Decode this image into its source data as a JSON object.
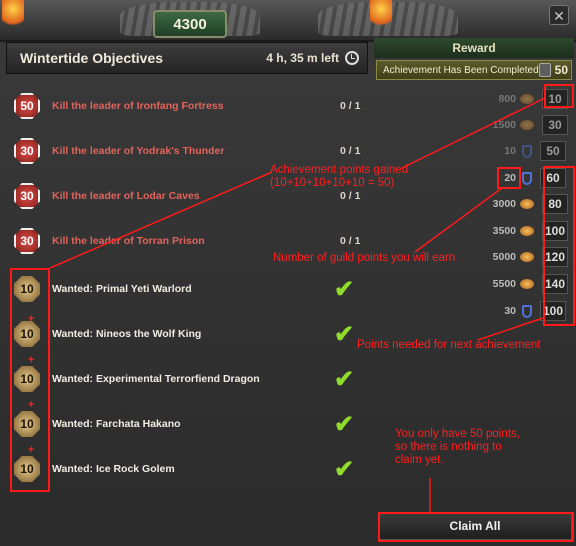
{
  "top": {
    "score": "4300"
  },
  "header": {
    "title": "Wintertide Objectives",
    "time_left": "4 h, 35 m left"
  },
  "reward": {
    "title": "Reward",
    "completed_label": "Achievement Has Been Completed",
    "completed_points": "50"
  },
  "objectives": [
    {
      "points": "50",
      "label": "Kill the leader of Ironfang Fortress",
      "progress": "0 / 1",
      "status": "incomplete"
    },
    {
      "points": "30",
      "label": "Kill the leader of Yodrak's Thunder",
      "progress": "0 / 1",
      "status": "incomplete"
    },
    {
      "points": "30",
      "label": "Kill the leader of Lodar Caves",
      "progress": "0 / 1",
      "status": "incomplete"
    },
    {
      "points": "30",
      "label": "Kill the leader of Torran Prison",
      "progress": "0 / 1",
      "status": "incomplete"
    },
    {
      "points": "10",
      "label": "Wanted: Primal Yeti Warlord",
      "status": "complete"
    },
    {
      "points": "10",
      "label": "Wanted: Nineos the Wolf King",
      "status": "complete"
    },
    {
      "points": "10",
      "label": "Wanted: Experimental Terrorfiend Dragon",
      "status": "complete"
    },
    {
      "points": "10",
      "label": "Wanted: Farchata Hakano",
      "status": "complete"
    },
    {
      "points": "10",
      "label": "Wanted: Ice Rock Golem",
      "status": "complete"
    }
  ],
  "rewards": [
    {
      "requirement": "800",
      "icon": "coin-icon",
      "points": "10",
      "state": "claimed"
    },
    {
      "requirement": "1500",
      "icon": "coin-icon",
      "points": "30",
      "state": "claimed"
    },
    {
      "requirement": "10",
      "icon": "guild-shield-icon",
      "points": "50",
      "state": "claimed"
    },
    {
      "requirement": "20",
      "icon": "guild-shield-icon",
      "points": "60",
      "state": "next"
    },
    {
      "requirement": "3000",
      "icon": "coin-icon",
      "points": "80",
      "state": "locked"
    },
    {
      "requirement": "3500",
      "icon": "coin-icon",
      "points": "100",
      "state": "locked"
    },
    {
      "requirement": "5000",
      "icon": "coin-icon",
      "points": "120",
      "state": "locked"
    },
    {
      "requirement": "5500",
      "icon": "coin-icon",
      "points": "140",
      "state": "locked"
    },
    {
      "requirement": "30",
      "icon": "guild-shield-icon",
      "points": "100",
      "state": "locked"
    }
  ],
  "claim_button": "Claim All",
  "annotations": {
    "achievement_gained_1": "Achievement points gained",
    "achievement_gained_2": "(10+10+10+10+10 = 50)",
    "guild_points": "Number of guild points you will earn",
    "points_needed": "Points needed for next achievement",
    "only_50_1": "You only have 50 points,",
    "only_50_2": "so there is nothing to",
    "only_50_3": "claim yet.",
    "plus": "+"
  },
  "colors": {
    "annotation": "#ff2020",
    "check": "#8fdc2a",
    "guild_icon": "#4d72d8"
  }
}
